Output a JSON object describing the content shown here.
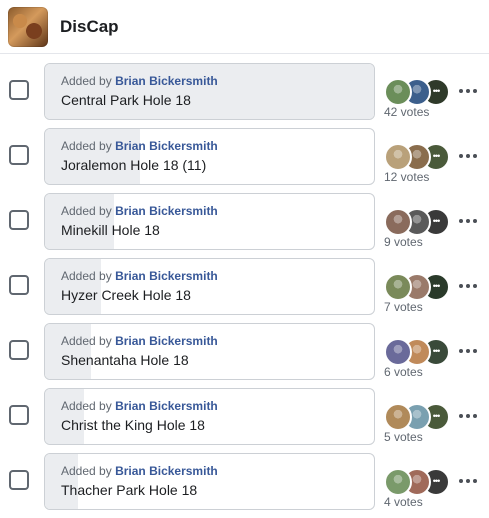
{
  "group": {
    "name": "DisCap"
  },
  "added_prefix": "Added by",
  "options": [
    {
      "label": "Central Park Hole 18",
      "author": "Brian Bickersmith",
      "votes_text": "42 votes",
      "vote_fraction": 1.0,
      "avatar_colors": [
        "#6b8e5a",
        "#3c5f8c",
        "#2f3a2a"
      ]
    },
    {
      "label": "Joralemon Hole 18 (11)",
      "author": "Brian Bickersmith",
      "votes_text": "12 votes",
      "vote_fraction": 0.29,
      "avatar_colors": [
        "#b9a17a",
        "#8a6d4d",
        "#4a5a3a"
      ]
    },
    {
      "label": "Minekill Hole 18",
      "author": "Brian Bickersmith",
      "votes_text": "9 votes",
      "vote_fraction": 0.21,
      "avatar_colors": [
        "#8a6b5c",
        "#5a5a5a",
        "#3a3a3a"
      ]
    },
    {
      "label": "Hyzer Creek Hole 18",
      "author": "Brian Bickersmith",
      "votes_text": "7 votes",
      "vote_fraction": 0.17,
      "avatar_colors": [
        "#7a8a5a",
        "#9a7a6a",
        "#2a3a2a"
      ]
    },
    {
      "label": "Shenantaha Hole 18",
      "author": "Brian Bickersmith",
      "votes_text": "6 votes",
      "vote_fraction": 0.14,
      "avatar_colors": [
        "#6a6a9a",
        "#c08a5a",
        "#3a4a3a"
      ]
    },
    {
      "label": "Christ the King Hole 18",
      "author": "Brian Bickersmith",
      "votes_text": "5 votes",
      "vote_fraction": 0.12,
      "avatar_colors": [
        "#b08a5a",
        "#7aa0b0",
        "#4a5a3a"
      ]
    },
    {
      "label": "Thacher Park Hole 18",
      "author": "Brian Bickersmith",
      "votes_text": "4 votes",
      "vote_fraction": 0.1,
      "avatar_colors": [
        "#7a9a6a",
        "#a06a5a",
        "#3a3a3a"
      ]
    }
  ],
  "more_avatars_icon": "ellipsis-icon",
  "row_menu_icon": "more-options-icon"
}
